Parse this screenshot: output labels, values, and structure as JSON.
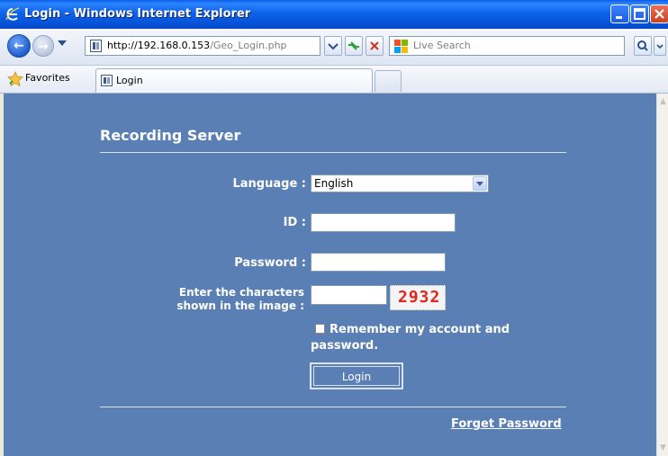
{
  "window": {
    "title": "Login - Windows Internet Explorer"
  },
  "address_bar": {
    "url_host": "http://192.168.0.153",
    "url_path": "/Geo_Login.php"
  },
  "search": {
    "placeholder": "Live Search"
  },
  "favorites": {
    "label": "Favorites"
  },
  "tab": {
    "label": "Login"
  },
  "page": {
    "heading": "Recording Server",
    "language_label": "Language :",
    "language_value": "English",
    "id_label": "ID :",
    "password_label": "Password :",
    "captcha_label_line1": "Enter the characters",
    "captcha_label_line2": "shown in the image :",
    "captcha_text": "2932",
    "remember_label": "Remember my account and password.",
    "login_button": "Login",
    "forget_password": "Forget Password"
  },
  "colors": {
    "page_background": "#5A7FB4",
    "title_bar": "#0A5CE8",
    "captcha_text": "#E1261C"
  }
}
